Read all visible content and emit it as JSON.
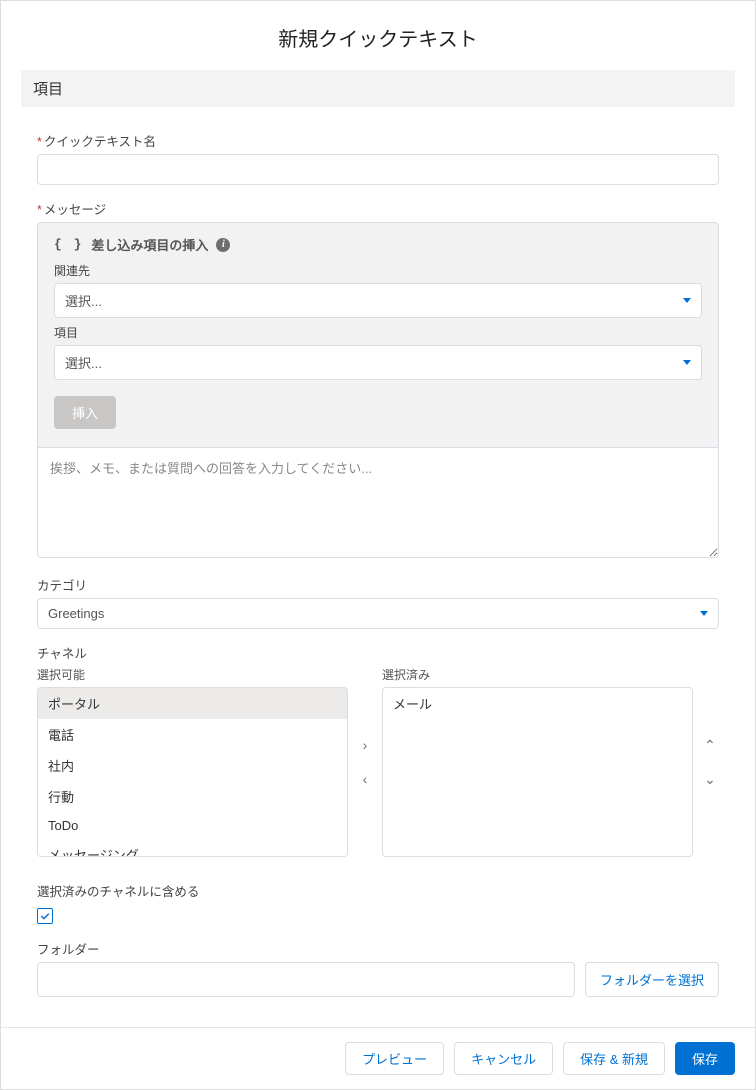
{
  "title": "新規クイックテキスト",
  "section_header": "項目",
  "fields": {
    "name_label": "クイックテキスト名",
    "message_label": "メッセージ",
    "category_label": "カテゴリ",
    "category_value": "Greetings",
    "channel_label": "チャネル",
    "include_label": "選択済みのチャネルに含める",
    "folder_label": "フォルダー",
    "folder_button": "フォルダーを選択"
  },
  "merge": {
    "title": "差し込み項目の挿入",
    "related_label": "関連先",
    "related_placeholder": "選択...",
    "field_label": "項目",
    "field_placeholder": "選択...",
    "insert_button": "挿入"
  },
  "textarea_placeholder": "挨拶、メモ、または質問への回答を入力してください...",
  "duallist": {
    "available_label": "選択可能",
    "selected_label": "選択済み",
    "available": [
      "ポータル",
      "電話",
      "社内",
      "行動",
      "ToDo",
      "メッセージング"
    ],
    "selected": [
      "メール"
    ]
  },
  "footer": {
    "preview": "プレビュー",
    "cancel": "キャンセル",
    "save_new": "保存 & 新規",
    "save": "保存"
  }
}
